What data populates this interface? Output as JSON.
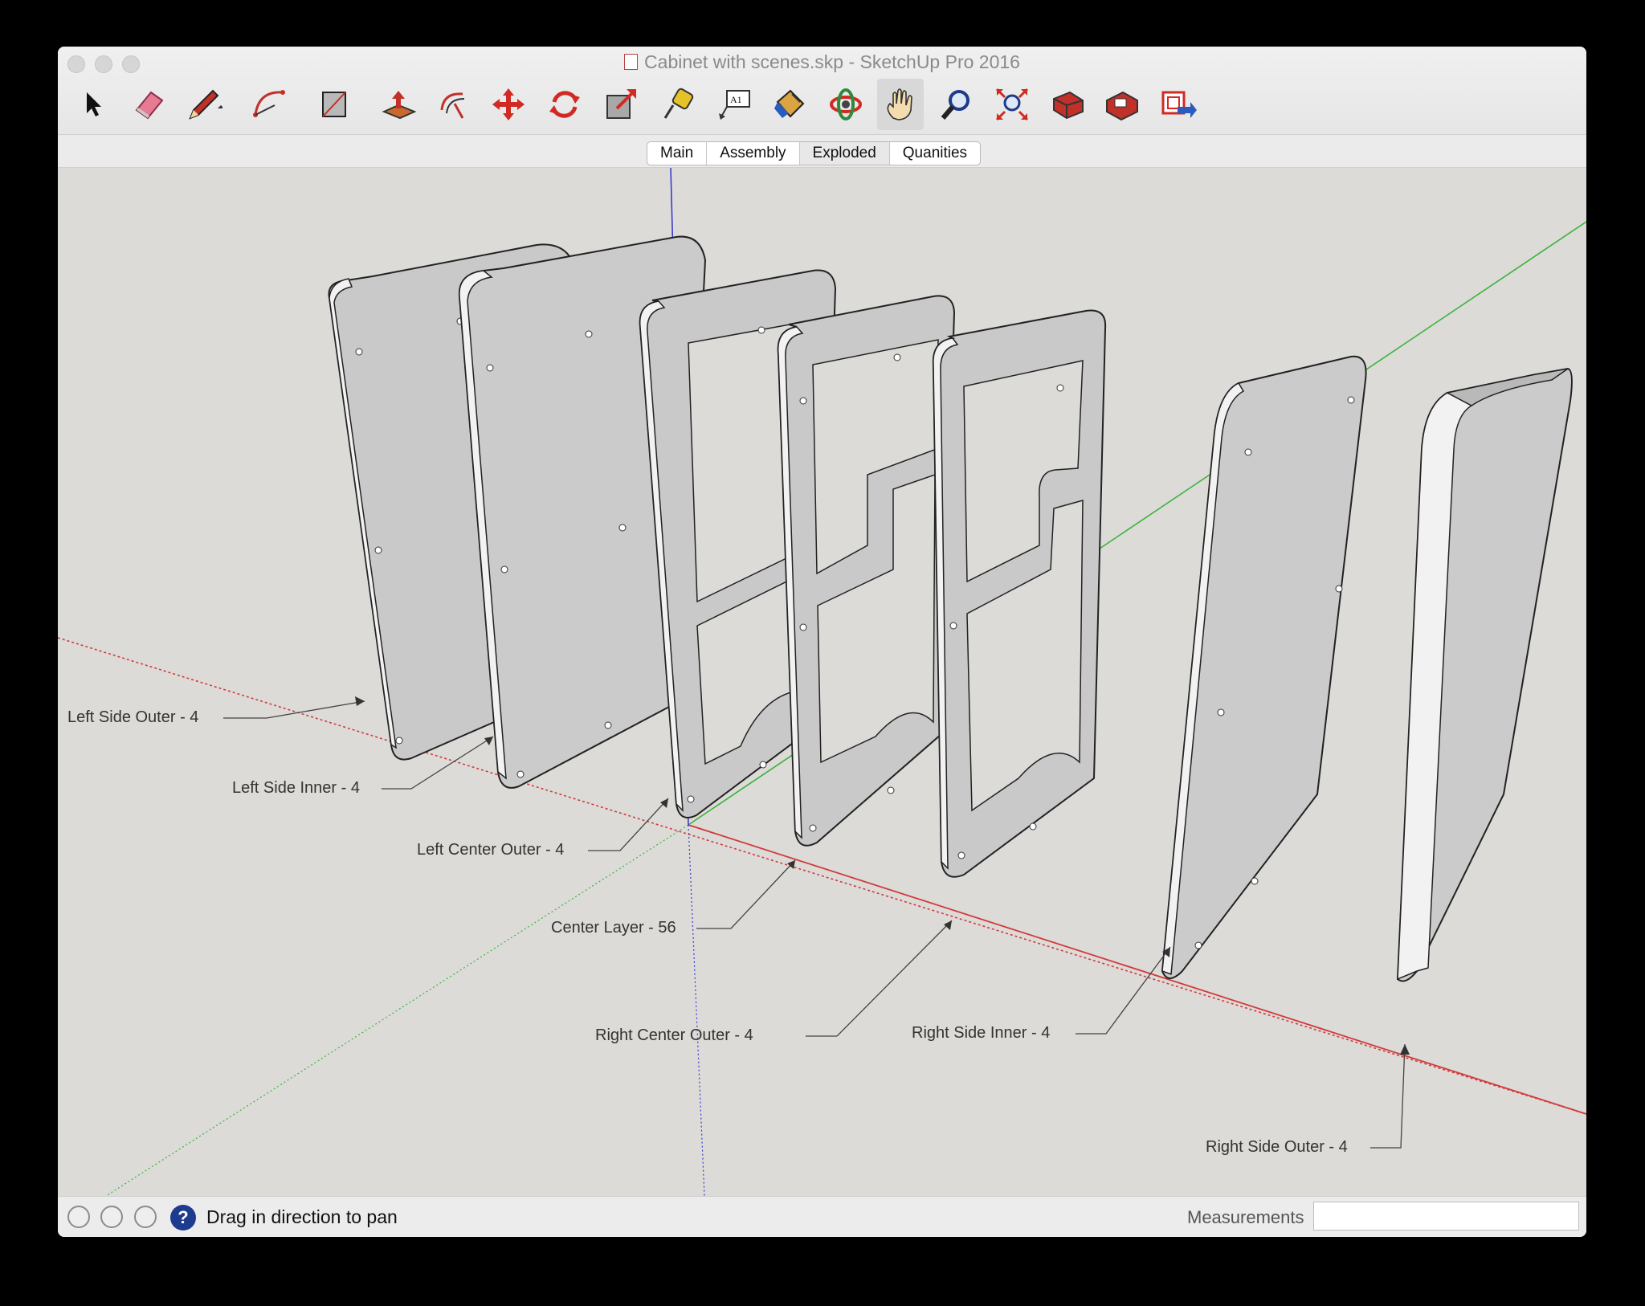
{
  "window": {
    "title": "Cabinet with scenes.skp - SketchUp Pro 2016"
  },
  "toolbar": {
    "tools": [
      {
        "name": "select",
        "icon": "arrow-cursor-icon"
      },
      {
        "name": "eraser",
        "icon": "eraser-icon"
      },
      {
        "name": "line",
        "icon": "pencil-icon"
      },
      {
        "name": "arc",
        "icon": "arc-icon"
      },
      {
        "name": "shapes",
        "icon": "rectangle-icon"
      },
      {
        "name": "push-pull",
        "icon": "push-pull-icon"
      },
      {
        "name": "offset",
        "icon": "offset-icon"
      },
      {
        "name": "move",
        "icon": "move-icon"
      },
      {
        "name": "rotate",
        "icon": "rotate-icon"
      },
      {
        "name": "scale",
        "icon": "scale-icon"
      },
      {
        "name": "tape-measure",
        "icon": "tape-measure-icon"
      },
      {
        "name": "text",
        "icon": "text-icon"
      },
      {
        "name": "paint-bucket",
        "icon": "paint-bucket-icon"
      },
      {
        "name": "orbit",
        "icon": "orbit-icon"
      },
      {
        "name": "pan",
        "icon": "hand-pan-icon",
        "active": true
      },
      {
        "name": "zoom",
        "icon": "magnifier-icon"
      },
      {
        "name": "zoom-extents",
        "icon": "zoom-extents-icon"
      },
      {
        "name": "warehouse",
        "icon": "3d-warehouse-icon"
      },
      {
        "name": "extension-warehouse",
        "icon": "extension-warehouse-icon"
      },
      {
        "name": "layout",
        "icon": "send-to-layout-icon"
      }
    ]
  },
  "scenes": {
    "tabs": [
      "Main",
      "Assembly",
      "Exploded",
      "Quanities"
    ],
    "selected": "Exploded"
  },
  "model": {
    "labels": {
      "left_side_outer": "Left Side Outer - 4",
      "left_side_inner": "Left Side Inner - 4",
      "left_center_outer": "Left Center Outer - 4",
      "center_layer": "Center Layer - 56",
      "right_center_outer": "Right Center Outer - 4",
      "right_side_inner": "Right Side Inner - 4",
      "right_side_outer": "Right Side Outer - 4"
    }
  },
  "statusbar": {
    "help_glyph": "?",
    "message": "Drag in direction to pan",
    "measurements_label": "Measurements",
    "measurements_value": ""
  },
  "colors": {
    "viewport_bg": "#dcdbd8",
    "panel_face": "#cbcbcb",
    "axis_red": "#d23a3a",
    "axis_green": "#3cb43c",
    "axis_blue": "#3b3bcc"
  }
}
